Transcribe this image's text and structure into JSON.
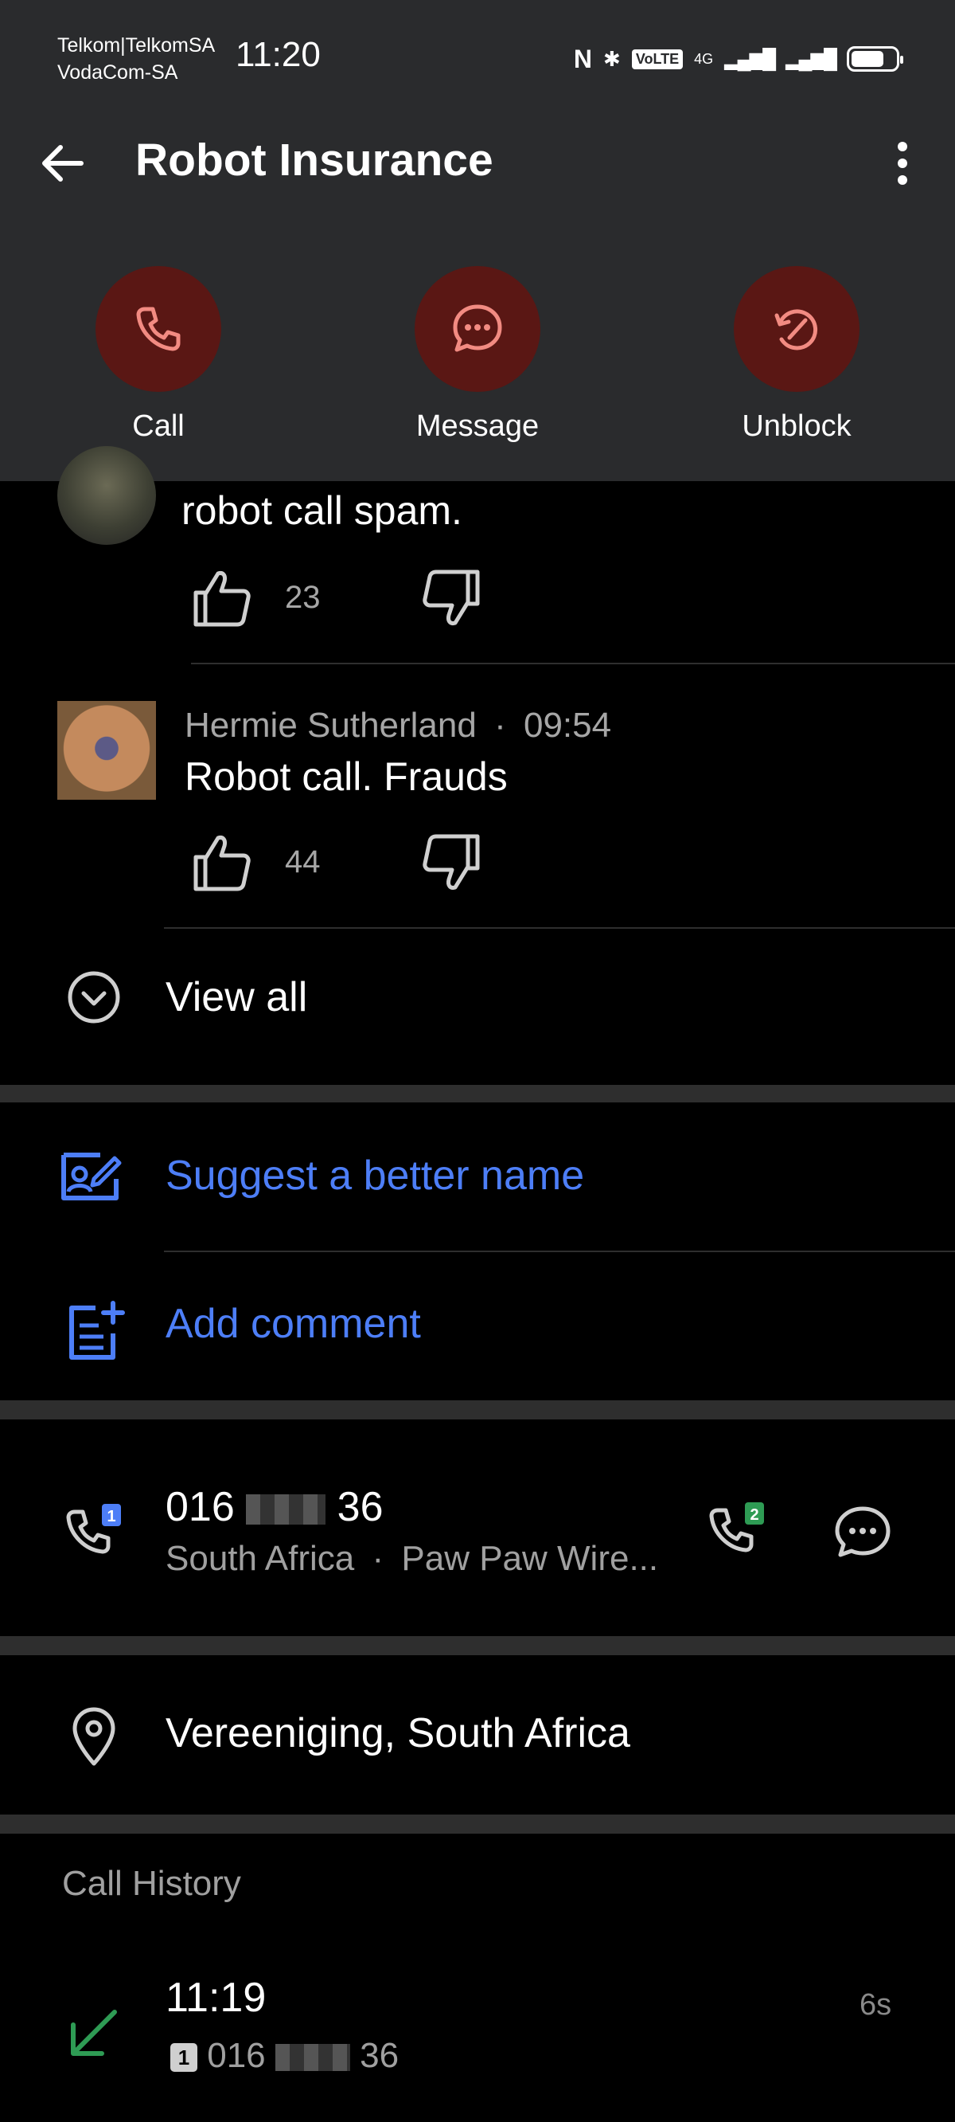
{
  "status_bar": {
    "carrier_line1": "Telkom|TelkomSA",
    "carrier_line2": "VodaCom-SA",
    "time": "11:20",
    "network": "4G",
    "volte": "VoLTE"
  },
  "header": {
    "title": "Robot Insurance",
    "back_icon": "arrow-left-icon",
    "more_icon": "more-vert-icon"
  },
  "actions": [
    {
      "label": "Call",
      "icon": "phone-icon"
    },
    {
      "label": "Message",
      "icon": "chat-bubble-icon"
    },
    {
      "label": "Unblock",
      "icon": "unblock-icon"
    }
  ],
  "comments": [
    {
      "text": "robot call spam.",
      "likes": "23"
    },
    {
      "author": "Hermie Sutherland",
      "separator": "·",
      "time": "09:54",
      "text": "Robot call. Frauds",
      "likes": "44"
    }
  ],
  "view_all_label": "View all",
  "suggest_label": "Suggest a better name",
  "add_comment_label": "Add comment",
  "number": {
    "prefix": "016",
    "suffix": "36",
    "country": "South Africa",
    "separator": "·",
    "carrier": "Paw Paw Wire...",
    "sim1": "1",
    "sim2": "2"
  },
  "location": "Vereeniging, South Africa",
  "call_history": {
    "title": "Call History",
    "entries": [
      {
        "time": "11:19",
        "sim": "1",
        "number_prefix": "016",
        "number_suffix": "36",
        "duration": "6s"
      }
    ]
  },
  "colors": {
    "header_bg": "#2a2b2d",
    "action_circle": "#5a1714",
    "action_icon": "#f28b82",
    "link_blue": "#4d7ef7",
    "incoming_green": "#2e9b54"
  }
}
